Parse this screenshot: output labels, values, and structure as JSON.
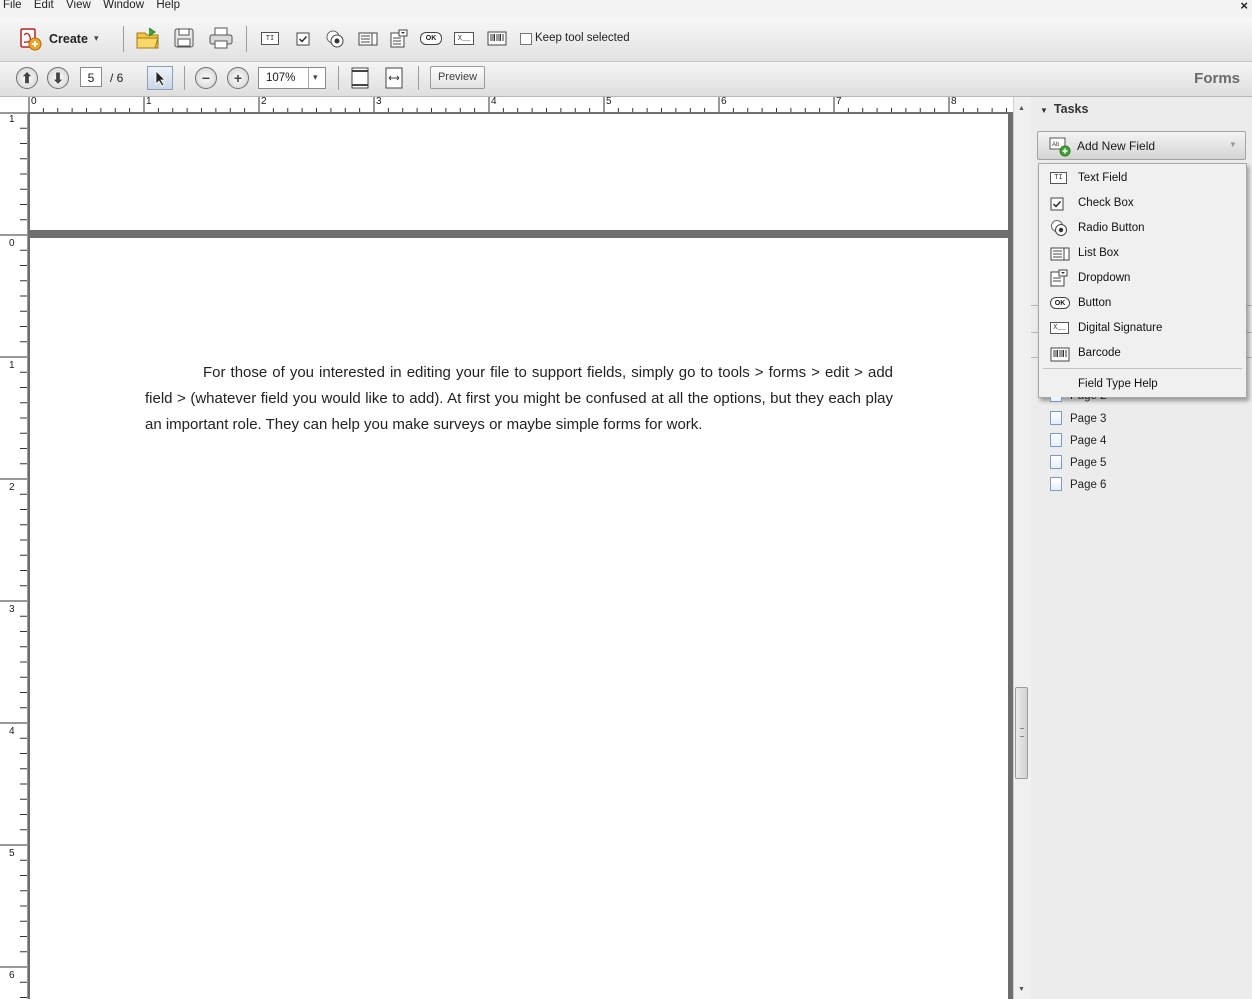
{
  "menubar": {
    "items": [
      "File",
      "Edit",
      "View",
      "Window",
      "Help"
    ],
    "close": "×"
  },
  "toolbar": {
    "create_label": "Create",
    "keep_tool_label": "Keep tool selected",
    "current_page": "5",
    "page_total": "/ 6",
    "zoom_value": "107%",
    "preview_label": "Preview",
    "panel_title": "Forms"
  },
  "ruler": {
    "top_labels": [
      "0",
      "1",
      "2",
      "3",
      "4",
      "5",
      "6",
      "7",
      "8"
    ],
    "left_labels": [
      "1",
      "0",
      "1",
      "2",
      "3",
      "4",
      "5",
      "6"
    ]
  },
  "document": {
    "body": "For those of you interested in editing your file to support fields, simply go to tools > forms > edit > add field > (whatever field you would like to add). At first you might be confused at all the options, but they each play an important role. They can help you make surveys or maybe simple forms for work."
  },
  "panel": {
    "tasks_label": "Tasks",
    "add_field_label": "Add New Field",
    "menu": [
      {
        "label": "Text Field",
        "icon": "text-field-icon"
      },
      {
        "label": "Check Box",
        "icon": "check-box-icon"
      },
      {
        "label": "Radio Button",
        "icon": "radio-button-icon"
      },
      {
        "label": "List Box",
        "icon": "list-box-icon"
      },
      {
        "label": "Dropdown",
        "icon": "dropdown-icon"
      },
      {
        "label": "Button",
        "icon": "button-icon"
      },
      {
        "label": "Digital Signature",
        "icon": "digital-signature-icon"
      },
      {
        "label": "Barcode",
        "icon": "barcode-icon"
      }
    ],
    "help_label": "Field Type Help",
    "pages": [
      "Page 2",
      "Page 3",
      "Page 4",
      "Page 5",
      "Page 6"
    ]
  },
  "colors": {
    "accent_green": "#3fa535",
    "doc_border": "#6e6e6e",
    "panel_bg": "#ececec"
  }
}
